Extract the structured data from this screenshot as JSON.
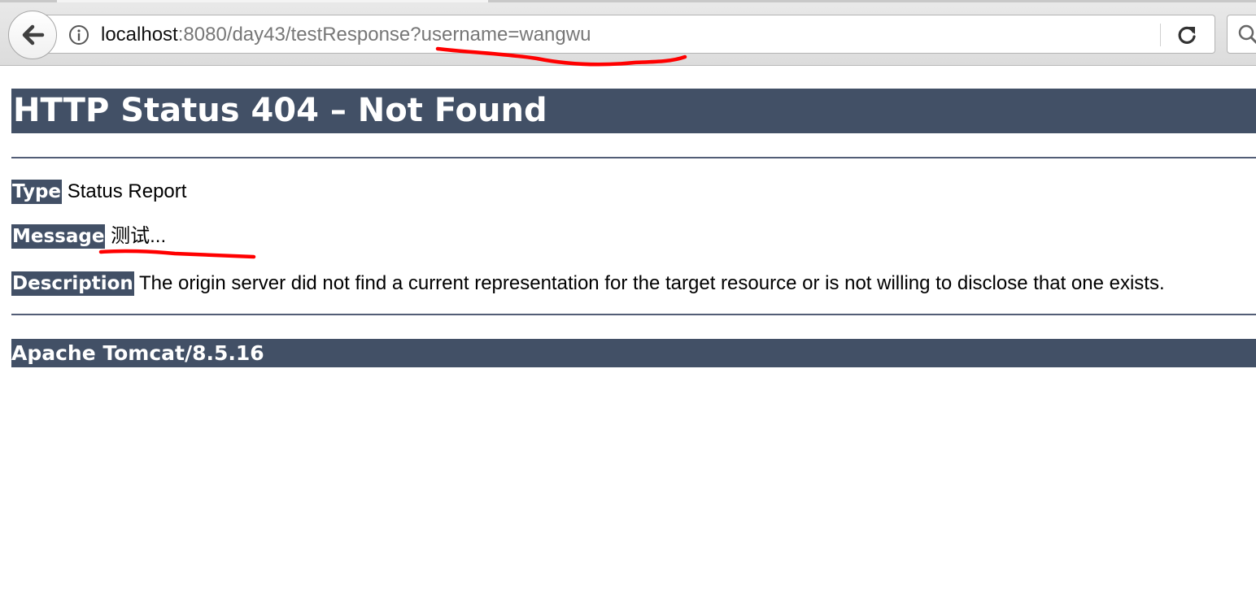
{
  "browser": {
    "url_host": "localhost",
    "url_rest": ":8080/day43/testResponse?username=wangwu",
    "icons": {
      "back": "back-arrow-icon",
      "info": "info-icon",
      "reload": "reload-icon",
      "search": "search-icon"
    }
  },
  "page": {
    "title": "HTTP Status 404 – Not Found",
    "type_label": "Type",
    "type_value": "Status Report",
    "message_label": "Message",
    "message_value": "测试...",
    "description_label": "Description",
    "description_value": "The origin server did not find a current representation for the target resource or is not willing to disclose that one exists.",
    "footer": "Apache Tomcat/8.5.16"
  },
  "colors": {
    "header_bg": "#425066",
    "annotation": "#ff0000"
  }
}
